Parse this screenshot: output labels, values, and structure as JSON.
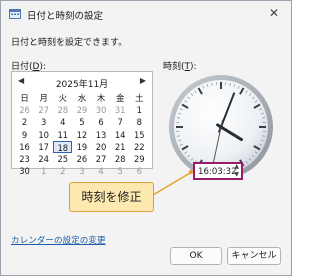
{
  "window": {
    "title": "日付と時刻の設定",
    "close_glyph": "✕"
  },
  "description": "日付と時刻を設定できます。",
  "date": {
    "label_prefix": "日付(",
    "label_key": "D",
    "label_suffix": "):"
  },
  "time": {
    "label_prefix": "時刻(",
    "label_key": "T",
    "label_suffix": "):",
    "value": "16:03:32",
    "clock": {
      "hour": 16,
      "minute": 3,
      "second": 32
    }
  },
  "calendar": {
    "month_title": "2025年11月",
    "prev_glyph": "◀",
    "next_glyph": "▶",
    "weekdays": [
      "日",
      "月",
      "火",
      "水",
      "木",
      "金",
      "土"
    ],
    "weeks": [
      [
        {
          "d": "26",
          "dim": true
        },
        {
          "d": "27",
          "dim": true
        },
        {
          "d": "28",
          "dim": true
        },
        {
          "d": "29",
          "dim": true
        },
        {
          "d": "30",
          "dim": true
        },
        {
          "d": "31",
          "dim": true
        },
        {
          "d": "1"
        }
      ],
      [
        {
          "d": "2"
        },
        {
          "d": "3"
        },
        {
          "d": "4"
        },
        {
          "d": "5"
        },
        {
          "d": "6"
        },
        {
          "d": "7"
        },
        {
          "d": "8"
        }
      ],
      [
        {
          "d": "9"
        },
        {
          "d": "10"
        },
        {
          "d": "11"
        },
        {
          "d": "12"
        },
        {
          "d": "13"
        },
        {
          "d": "14"
        },
        {
          "d": "15"
        }
      ],
      [
        {
          "d": "16"
        },
        {
          "d": "17"
        },
        {
          "d": "18",
          "selected": true
        },
        {
          "d": "19"
        },
        {
          "d": "20"
        },
        {
          "d": "21"
        },
        {
          "d": "22"
        }
      ],
      [
        {
          "d": "23"
        },
        {
          "d": "24"
        },
        {
          "d": "25"
        },
        {
          "d": "26"
        },
        {
          "d": "27"
        },
        {
          "d": "28"
        },
        {
          "d": "29"
        }
      ],
      [
        {
          "d": "30"
        },
        {
          "d": "1",
          "dim": true
        },
        {
          "d": "2",
          "dim": true
        },
        {
          "d": "3",
          "dim": true
        },
        {
          "d": "4",
          "dim": true
        },
        {
          "d": "5",
          "dim": true
        },
        {
          "d": "6",
          "dim": true
        }
      ]
    ]
  },
  "callout": {
    "text": "時刻を修正"
  },
  "spinner": {
    "up_glyph": "▲",
    "down_glyph": "▼"
  },
  "footer": {
    "calendar_link": "カレンダーの設定の変更",
    "ok": "OK",
    "cancel": "キャンセル"
  },
  "colors": {
    "highlight_border": "#9b1b6b",
    "callout_fill": "#fde9b0",
    "callout_line": "#e8a32e",
    "link": "#1b5cab"
  }
}
